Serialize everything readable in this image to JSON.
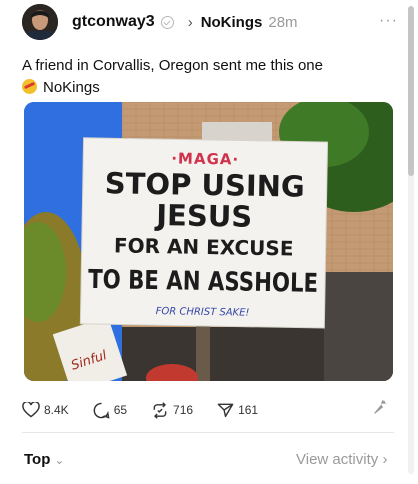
{
  "post": {
    "author": "gtconway3",
    "community": "NoKings",
    "timestamp": "28m",
    "caption_line1": "A friend in Corvallis, Oregon sent me this one",
    "caption_tag": "NoKings",
    "icons": {
      "more": "more-horizontal-icon",
      "verified": "verified-check-icon",
      "chevron": "chevron-right-icon"
    }
  },
  "sign": {
    "line1": "·MAGA·",
    "line2": "STOP USING",
    "line3": "JESUS",
    "line4": "FOR AN EXCUSE",
    "line5": "TO BE AN ASSHOLE",
    "line6": "FOR CHRIST SAKE!",
    "small_sign": "Sinful"
  },
  "actions": {
    "likes": "8.4K",
    "replies": "65",
    "reposts": "716",
    "shares": "161",
    "icons": [
      "heart-icon",
      "reply-icon",
      "repost-icon",
      "share-icon",
      "wrench-icon"
    ]
  },
  "footer": {
    "sort_label": "Top",
    "activity_link": "View activity"
  },
  "colors": {
    "text": "#101010",
    "muted": "#9a9a9a",
    "sign_text": "#1c1c1c",
    "sign_accent": "#d0314b",
    "sign_blue": "#3548a8"
  }
}
